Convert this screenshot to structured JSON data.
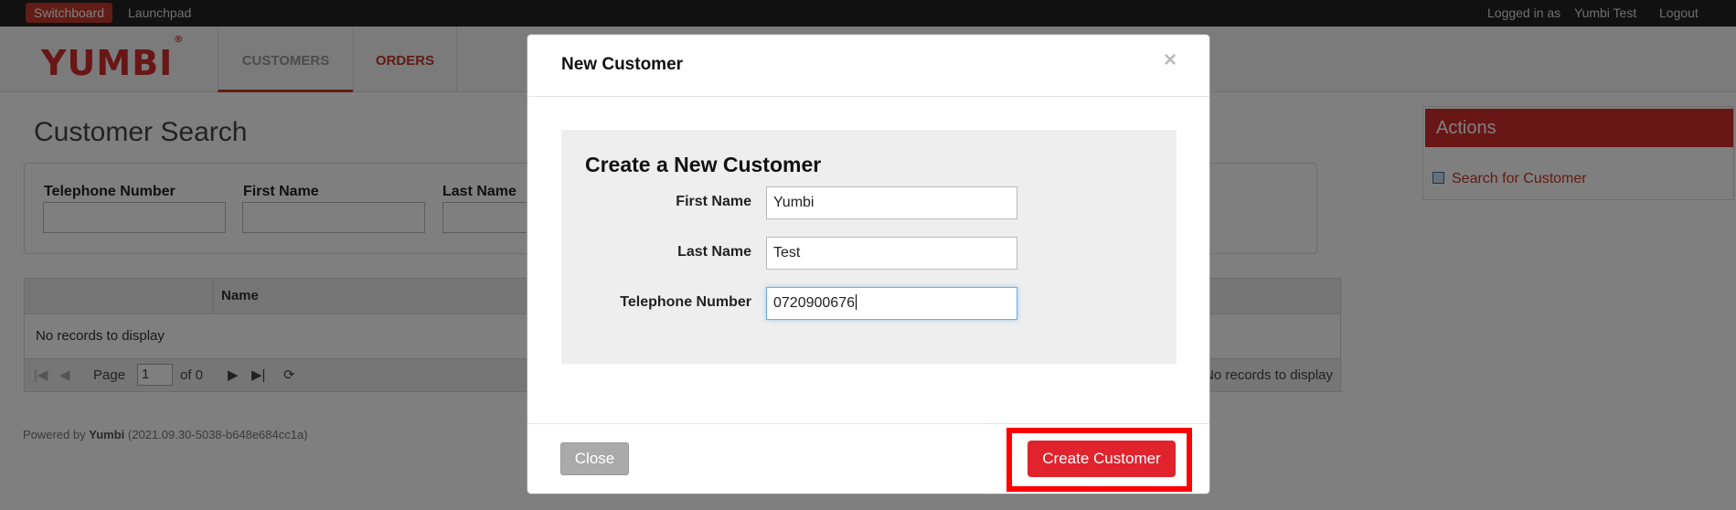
{
  "topbar": {
    "switchboard": "Switchboard",
    "launchpad": "Launchpad",
    "logged_in_as": "Logged in as",
    "username": "Yumbi Test",
    "logout": "Logout"
  },
  "header": {
    "logo": "YUMBI",
    "logo_mark": "®",
    "tabs": [
      {
        "label": "CUSTOMERS"
      },
      {
        "label": "ORDERS"
      }
    ]
  },
  "page": {
    "title": "Customer Search",
    "search_fields": [
      {
        "label": "Telephone Number",
        "value": ""
      },
      {
        "label": "First Name",
        "value": ""
      },
      {
        "label": "Last Name",
        "value": ""
      }
    ],
    "grid": {
      "columns": [
        "",
        "Name"
      ],
      "empty_text": "No records to display"
    },
    "pager": {
      "page_label": "Page",
      "page_value": "1",
      "of_label": "of 0",
      "status": "No records to display"
    },
    "footer": {
      "powered_by": "Powered by",
      "brand": "Yumbi",
      "version": "(2021.09.30-5038-b648e684cc1a)"
    }
  },
  "actions": {
    "title": "Actions",
    "items": [
      {
        "label": "Search for Customer"
      }
    ]
  },
  "modal": {
    "title": "New Customer",
    "close_x": "×",
    "heading": "Create a New Customer",
    "fields": [
      {
        "label": "First Name",
        "value": "Yumbi"
      },
      {
        "label": "Last Name",
        "value": "Test"
      },
      {
        "label": "Telephone Number",
        "value": "0720900676"
      }
    ],
    "close_label": "Close",
    "create_label": "Create Customer"
  },
  "colors": {
    "brand_red": "#d22d2d",
    "highlight": "#ff0000"
  }
}
